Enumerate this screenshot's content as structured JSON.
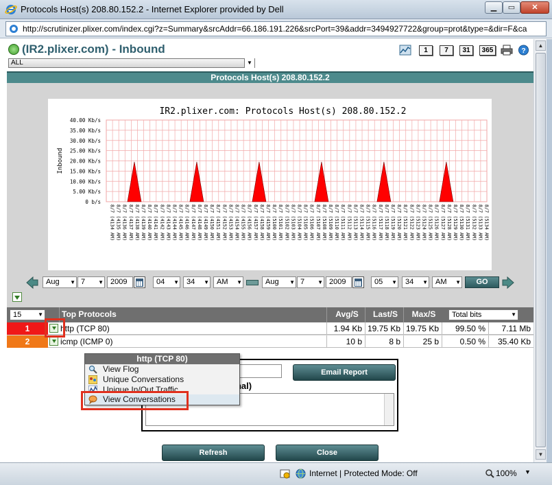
{
  "window": {
    "title": "Protocols Host(s) 208.80.152.2 - Internet Explorer provided by Dell",
    "url": "http://scrutinizer.plixer.com/index.cgi?z=Summary&srcAddr=66.186.191.226&srcPort=39&addr=3494927722&group=prot&type=&dir=F&ca"
  },
  "header": {
    "title": "(IR2.plixer.com) - Inbound",
    "day_buttons": [
      "1",
      "7",
      "31",
      "365"
    ]
  },
  "filter": {
    "value": "ALL"
  },
  "section_title": "Protocols Host(s) 208.80.152.2",
  "chart_data": {
    "type": "area",
    "title": "IR2.plixer.com: Protocols Host(s) 208.80.152.2",
    "ylabel": "Inbound",
    "ylim": [
      0,
      40
    ],
    "y_ticks": [
      "40.00 Kb/s",
      "35.00 Kb/s",
      "30.00 Kb/s",
      "25.00 Kb/s",
      "20.00 Kb/s",
      "15.00 Kb/s",
      "10.00 Kb/s",
      "5.00 Kb/s",
      "0 b/s"
    ],
    "x_ticks": [
      "8/7 (4134 AM)",
      "8/7 (4135 AM)",
      "8/7 (4136 AM)",
      "8/7 (4137 AM)",
      "8/7 (4138 AM)",
      "8/7 (4139 AM)",
      "8/7 (4140 AM)",
      "8/7 (4141 AM)",
      "8/7 (4142 AM)",
      "8/7 (4143 AM)",
      "8/7 (4144 AM)",
      "8/7 (4145 AM)",
      "8/7 (4146 AM)",
      "8/7 (4147 AM)",
      "8/7 (4148 AM)",
      "8/7 (4149 AM)",
      "8/7 (4150 AM)",
      "8/7 (4151 AM)",
      "8/7 (4152 AM)",
      "8/7 (4153 AM)",
      "8/7 (4154 AM)",
      "8/7 (4155 AM)",
      "8/7 (4156 AM)",
      "8/7 (4157 AM)",
      "8/7 (4158 AM)",
      "8/7 (4159 AM)",
      "8/7 (5100 AM)",
      "8/7 (5101 AM)",
      "8/7 (5102 AM)",
      "8/7 (5103 AM)",
      "8/7 (5104 AM)",
      "8/7 (5105 AM)",
      "8/7 (5106 AM)",
      "8/7 (5107 AM)",
      "8/7 (5108 AM)",
      "8/7 (5109 AM)",
      "8/7 (5110 AM)",
      "8/7 (5111 AM)",
      "8/7 (5112 AM)",
      "8/7 (5113 AM)",
      "8/7 (5114 AM)",
      "8/7 (5115 AM)",
      "8/7 (5116 AM)",
      "8/7 (5117 AM)",
      "8/7 (5118 AM)",
      "8/7 (5119 AM)",
      "8/7 (5120 AM)",
      "8/7 (5121 AM)",
      "8/7 (5122 AM)",
      "8/7 (5123 AM)",
      "8/7 (5124 AM)",
      "8/7 (5125 AM)",
      "8/7 (5126 AM)",
      "8/7 (5127 AM)",
      "8/7 (5128 AM)",
      "8/7 (5129 AM)",
      "8/7 (5130 AM)",
      "8/7 (5131 AM)",
      "8/7 (5132 AM)",
      "8/7 (5133 AM)",
      "8/7 (5134 AM)"
    ],
    "series": [
      {
        "color": "#ff0000",
        "values": [
          0,
          0,
          0,
          0,
          19.5,
          0,
          0,
          0,
          0,
          0,
          0,
          0,
          0,
          0,
          19.5,
          0,
          0,
          0,
          0,
          0,
          0,
          0,
          0,
          0,
          19.5,
          0,
          0,
          0,
          0,
          0,
          0,
          0,
          0,
          0,
          19.5,
          0,
          0,
          0,
          0,
          0,
          0,
          0,
          0,
          0,
          19.5,
          0,
          0,
          0,
          0,
          0,
          0,
          0,
          0,
          0,
          19.5,
          0,
          0,
          0,
          0,
          0,
          0
        ]
      }
    ],
    "grid": true
  },
  "date_range": {
    "from": {
      "month": "Aug",
      "day": "7",
      "year": "2009",
      "hour": "04",
      "minute": "34",
      "ampm": "AM"
    },
    "to": {
      "month": "Aug",
      "day": "7",
      "year": "2009",
      "hour": "05",
      "minute": "34",
      "ampm": "AM"
    },
    "go_label": "GO"
  },
  "table": {
    "rows_select": "15",
    "headers": {
      "name": "Top Protocols",
      "avg": "Avg/S",
      "last": "Last/S",
      "max": "Max/S",
      "total_select": "Total bits"
    },
    "rows": [
      {
        "rank": "1",
        "rank_color": "#f01818",
        "name": "http (TCP 80)",
        "avg": "1.94 Kb",
        "last": "19.75 Kb",
        "max": "19.75 Kb",
        "pct": "99.50 %",
        "total": "7.11 Mb"
      },
      {
        "rank": "2",
        "rank_color": "#f07818",
        "name": "icmp (ICMP 0)",
        "avg": "10 b",
        "last": "8 b",
        "max": "25 b",
        "pct": "0.50 %",
        "total": "35.40 Kb"
      }
    ]
  },
  "context_menu": {
    "title": "http (TCP 80)",
    "items": [
      "View Flog",
      "Unique Conversations",
      "Unique In/Out Traffic",
      "View Conversations"
    ]
  },
  "form": {
    "email_button": "Email Report",
    "optional_label": "onal)"
  },
  "buttons": {
    "refresh": "Refresh",
    "close": "Close"
  },
  "status": {
    "zone": "Internet | Protected Mode: Off",
    "zoom": "100%"
  }
}
